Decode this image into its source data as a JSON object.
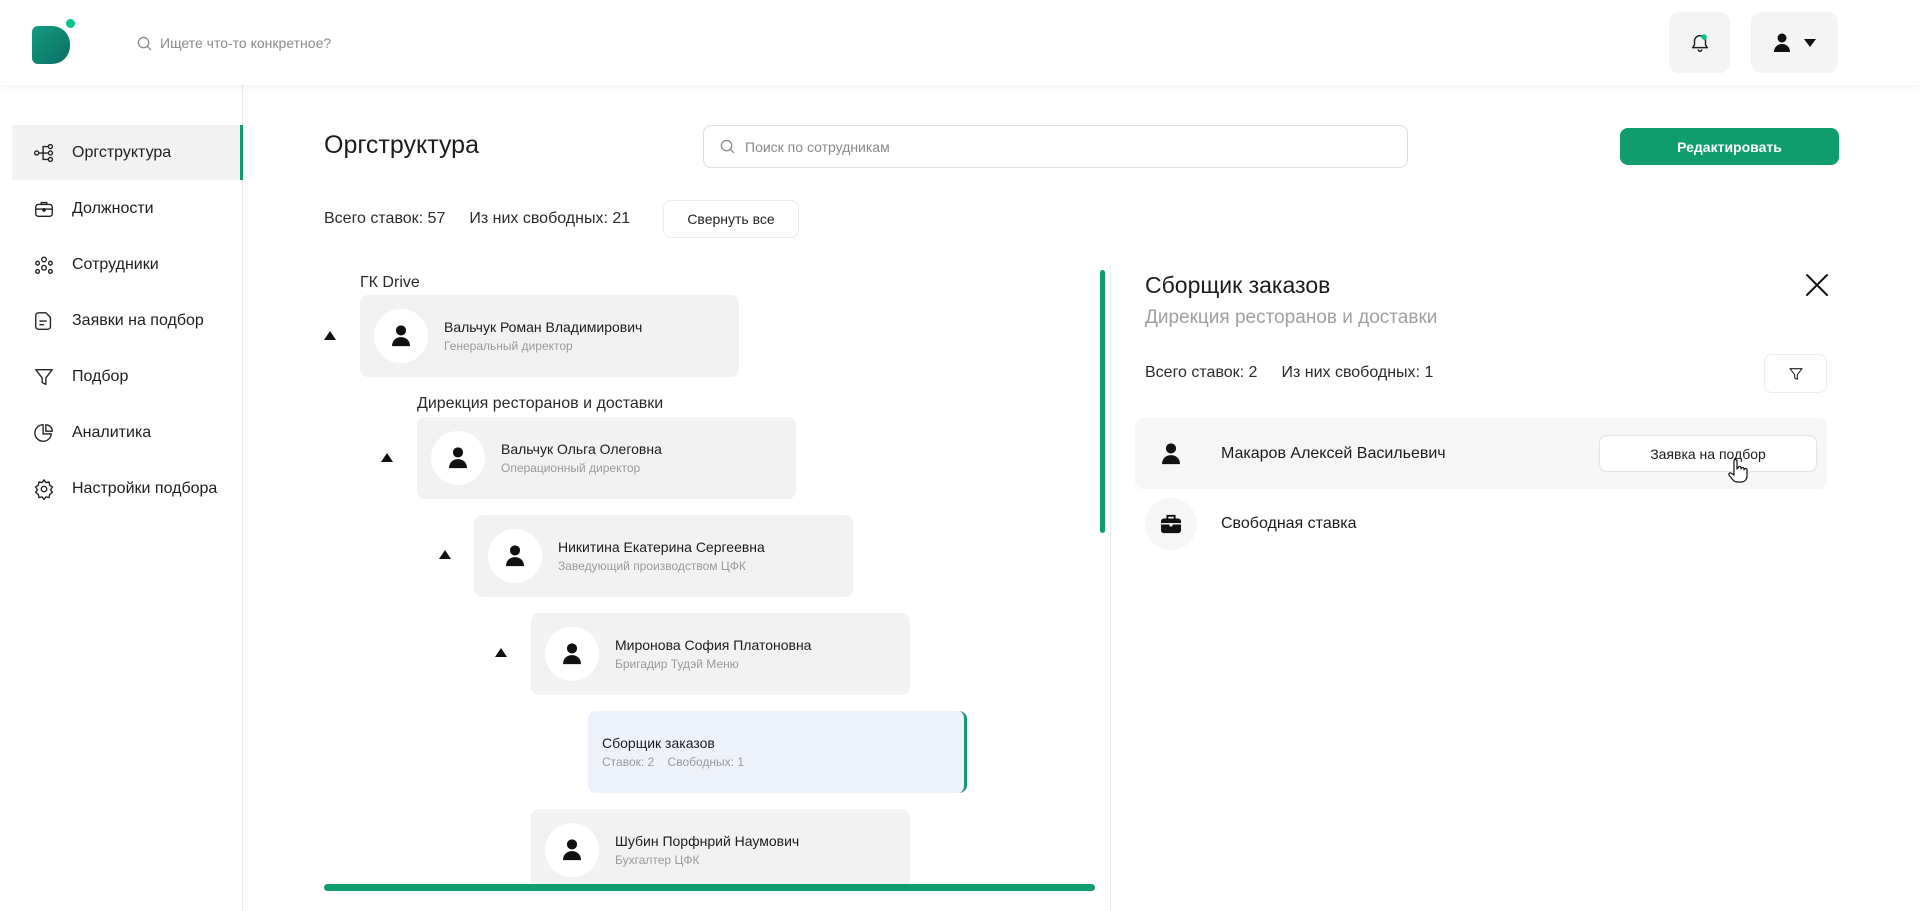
{
  "header": {
    "search_placeholder": "Ищете что-то конкретное?"
  },
  "sidebar": {
    "items": [
      {
        "label": "Оргструктура",
        "icon": "org-structure-icon",
        "active": true
      },
      {
        "label": "Должности",
        "icon": "briefcase-icon",
        "active": false
      },
      {
        "label": "Сотрудники",
        "icon": "people-icon",
        "active": false
      },
      {
        "label": "Заявки на подбор",
        "icon": "document-icon",
        "active": false
      },
      {
        "label": "Подбор",
        "icon": "funnel-icon",
        "active": false
      },
      {
        "label": "Аналитика",
        "icon": "pie-chart-icon",
        "active": false
      },
      {
        "label": "Настройки подбора",
        "icon": "gear-icon",
        "active": false
      }
    ]
  },
  "main": {
    "title": "Оргструктура",
    "employee_search_placeholder": "Поиск по сотрудникам",
    "edit_label": "Редактировать",
    "total_label": "Всего ставок: 57",
    "free_label": "Из них свободных: 21",
    "collapse_label": "Свернуть все"
  },
  "tree": {
    "groups": [
      "ГК Drive",
      "Дирекция ресторанов и доставки"
    ],
    "nodes": [
      {
        "name": "Вальчук Роман Владимирович",
        "role": "Генеральный директор"
      },
      {
        "name": "Вальчук Ольга Олеговна",
        "role": "Операционный директор"
      },
      {
        "name": "Никитина Екатерина Сергеевна",
        "role": "Заведующий производством ЦФК"
      },
      {
        "name": "Миронова София Платоновна",
        "role": "Бригадир Тудэй Меню"
      },
      {
        "name": "Сборщик заказов",
        "role": "Ставок: 2    Свободных: 1",
        "selected": true
      },
      {
        "name": "Шубин Порфнрий Наумович",
        "role": "Бухгалтер ЦФК"
      }
    ]
  },
  "panel": {
    "title": "Сборщик заказов",
    "subtitle": "Дирекция ресторанов и доставки",
    "total_label": "Всего ставок: 2",
    "free_label": "Из них свободных: 1",
    "rows": [
      {
        "name": "Макаров Алексей Васильевич",
        "icon": "user-icon"
      },
      {
        "name": "Свободная ставка",
        "icon": "briefcase-icon"
      }
    ],
    "request_label": "Заявка на подбор"
  },
  "colors": {
    "accent": "#0f9d6e",
    "selected_bg": "#eef2fb",
    "node_bg": "#f2f2f2"
  }
}
